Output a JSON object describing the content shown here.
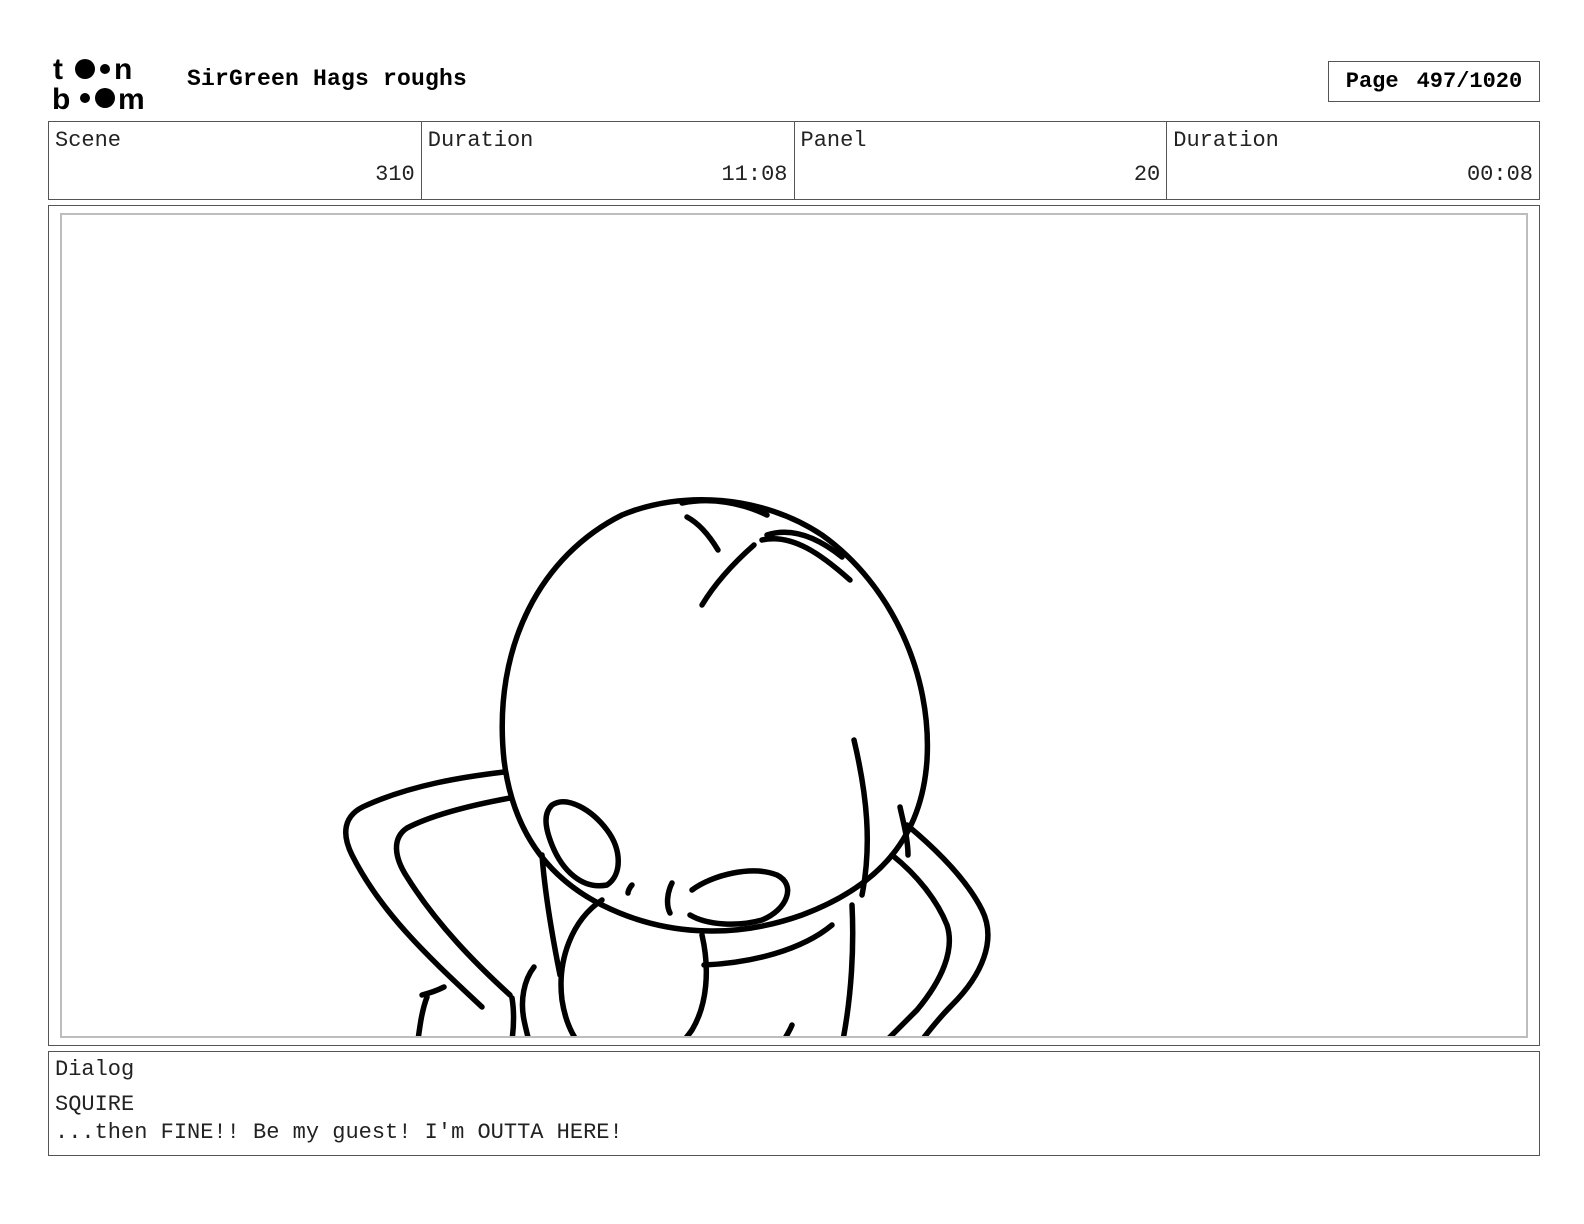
{
  "header": {
    "logo_text": "toon boom",
    "title": "SirGreen Hags roughs",
    "page_label": "Page",
    "page_value": "497/1020"
  },
  "info": {
    "scene_label": "Scene",
    "scene_value": "310",
    "scene_duration_label": "Duration",
    "scene_duration_value": "11:08",
    "panel_label": "Panel",
    "panel_value": "20",
    "panel_duration_label": "Duration",
    "panel_duration_value": "00:08"
  },
  "dialog": {
    "label": "Dialog",
    "speaker": "SQUIRE",
    "line": "...then FINE!! Be my guest! I'm OUTTA HERE!"
  },
  "colors": {
    "border": "#555555",
    "panel_inner_border": "#bdbdbd",
    "ink": "#000000"
  }
}
